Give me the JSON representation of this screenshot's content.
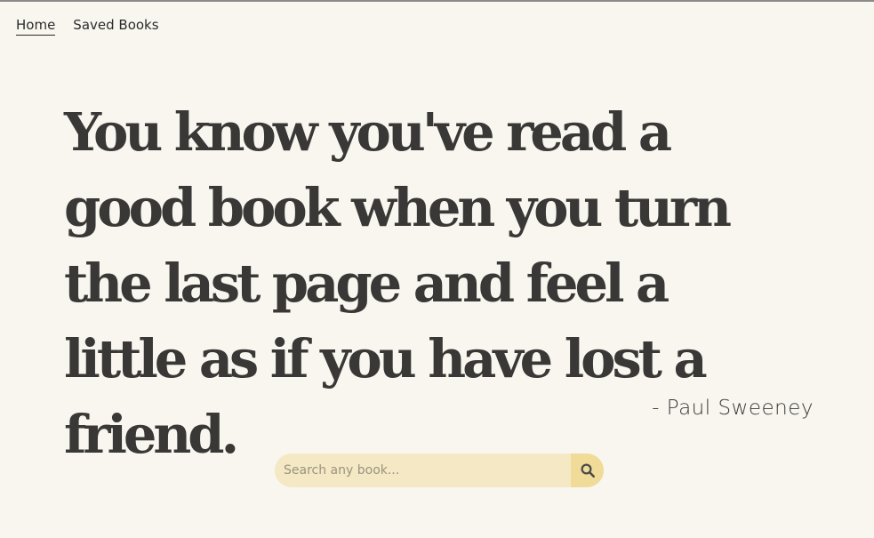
{
  "nav": {
    "items": [
      {
        "label": "Home",
        "active": true
      },
      {
        "label": "Saved Books",
        "active": false
      }
    ]
  },
  "hero": {
    "quote": "You know you've read a good book when you turn the last page and feel a little as if you have lost a friend.",
    "author": "- Paul Sweeney"
  },
  "search": {
    "placeholder": "Search any book...",
    "value": "",
    "button_icon": "search-icon"
  },
  "colors": {
    "background": "#f8f6ef",
    "text": "#3a3836",
    "search_field": "#f4e9c4",
    "search_button": "#f0dc98"
  }
}
